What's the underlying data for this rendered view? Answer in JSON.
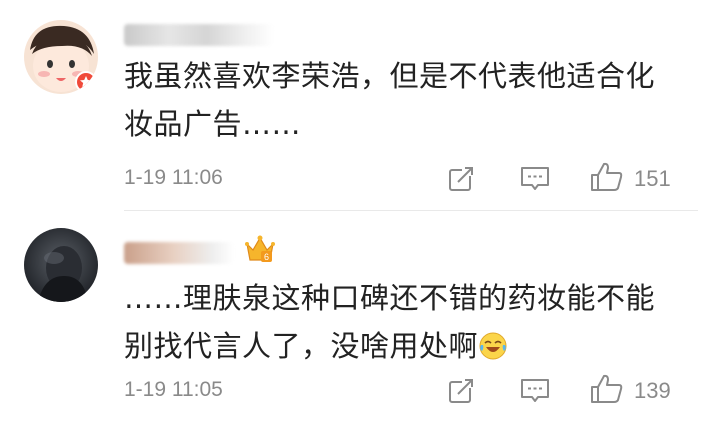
{
  "comments": [
    {
      "text": "我虽然喜欢李荣浩，但是不代表他适合化妆品广告……",
      "time": "1-19 11:06",
      "likes": "151"
    },
    {
      "text": "……理肤泉这种口碑还不错的药妆能不能别找代言人了，没啥用处啊",
      "time": "1-19 11:05",
      "likes": "139"
    }
  ],
  "icons": {
    "share": "share-icon",
    "comment": "comment-icon",
    "like": "thumbs-up-icon",
    "emoji": "laughing-crying-emoji"
  }
}
